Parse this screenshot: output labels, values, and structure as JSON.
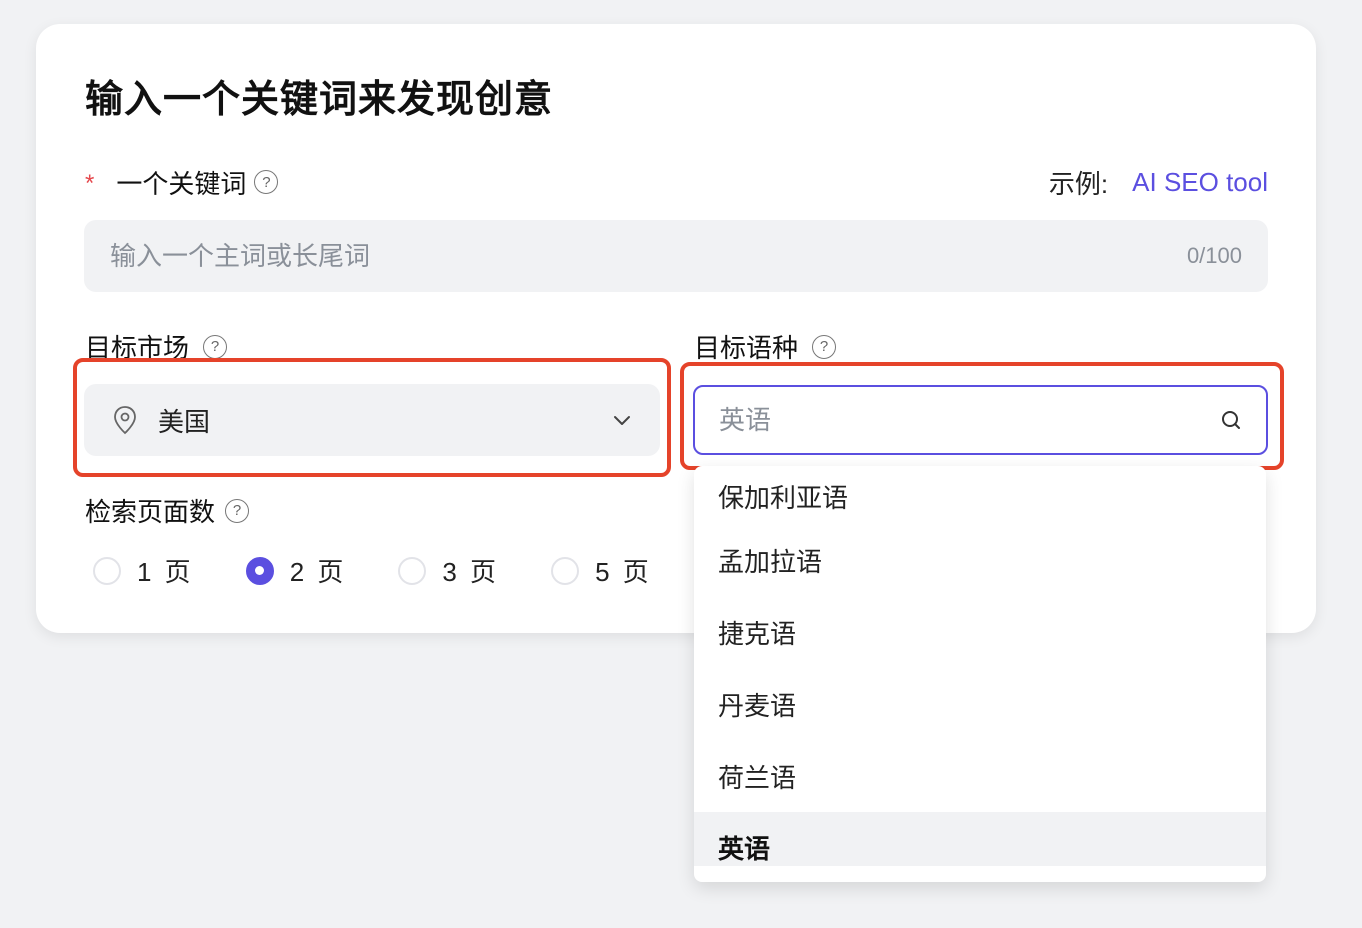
{
  "form": {
    "title": "输入一个关键词来发现创意",
    "keyword": {
      "required_mark": "*",
      "label": "一个关键词",
      "help": "?",
      "example_label": "示例:",
      "example_value": "AI SEO tool",
      "placeholder": "输入一个主词或长尾词",
      "value": "",
      "counter": "0/100"
    },
    "market": {
      "label": "目标市场",
      "help": "?",
      "value": "美国",
      "icon": "location-pin-icon"
    },
    "language": {
      "label": "目标语种",
      "help": "?",
      "placeholder": "英语",
      "value": "",
      "icon": "search-icon",
      "options": [
        {
          "label": "保加利亚语",
          "active": false
        },
        {
          "label": "孟加拉语",
          "active": false
        },
        {
          "label": "捷克语",
          "active": false
        },
        {
          "label": "丹麦语",
          "active": false
        },
        {
          "label": "荷兰语",
          "active": false
        },
        {
          "label": "英语",
          "active": true
        }
      ]
    },
    "pages": {
      "label": "检索页面数",
      "help": "?",
      "options": [
        {
          "label": "1 页",
          "checked": false
        },
        {
          "label": "2 页",
          "checked": true
        },
        {
          "label": "3 页",
          "checked": false
        },
        {
          "label": "5 页",
          "checked": false
        }
      ]
    }
  },
  "colors": {
    "accent": "#5b4fe0",
    "required": "#e5484d",
    "highlight": "#e5432a",
    "field_bg": "#f1f2f4"
  }
}
